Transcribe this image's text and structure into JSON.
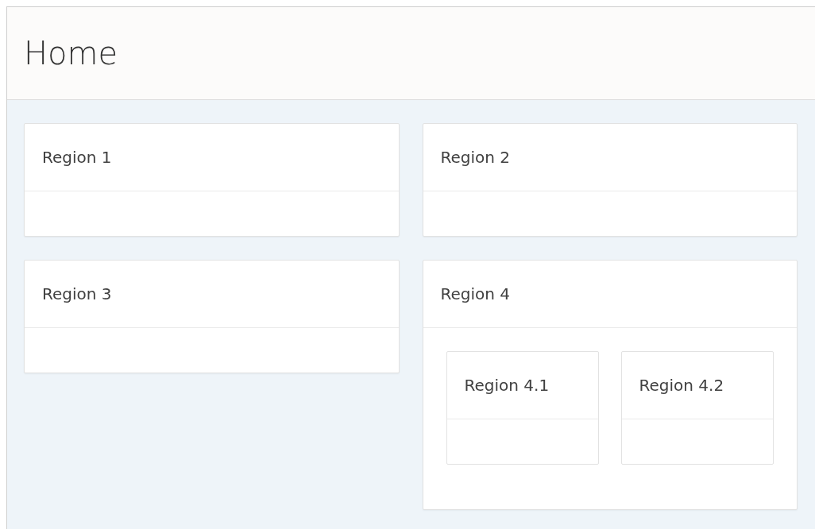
{
  "page": {
    "title": "Home"
  },
  "regions": [
    {
      "title": "Region 1"
    },
    {
      "title": "Region 2"
    },
    {
      "title": "Region 3"
    },
    {
      "title": "Region 4",
      "children": [
        {
          "title": "Region 4.1"
        },
        {
          "title": "Region 4.2"
        }
      ]
    }
  ]
}
